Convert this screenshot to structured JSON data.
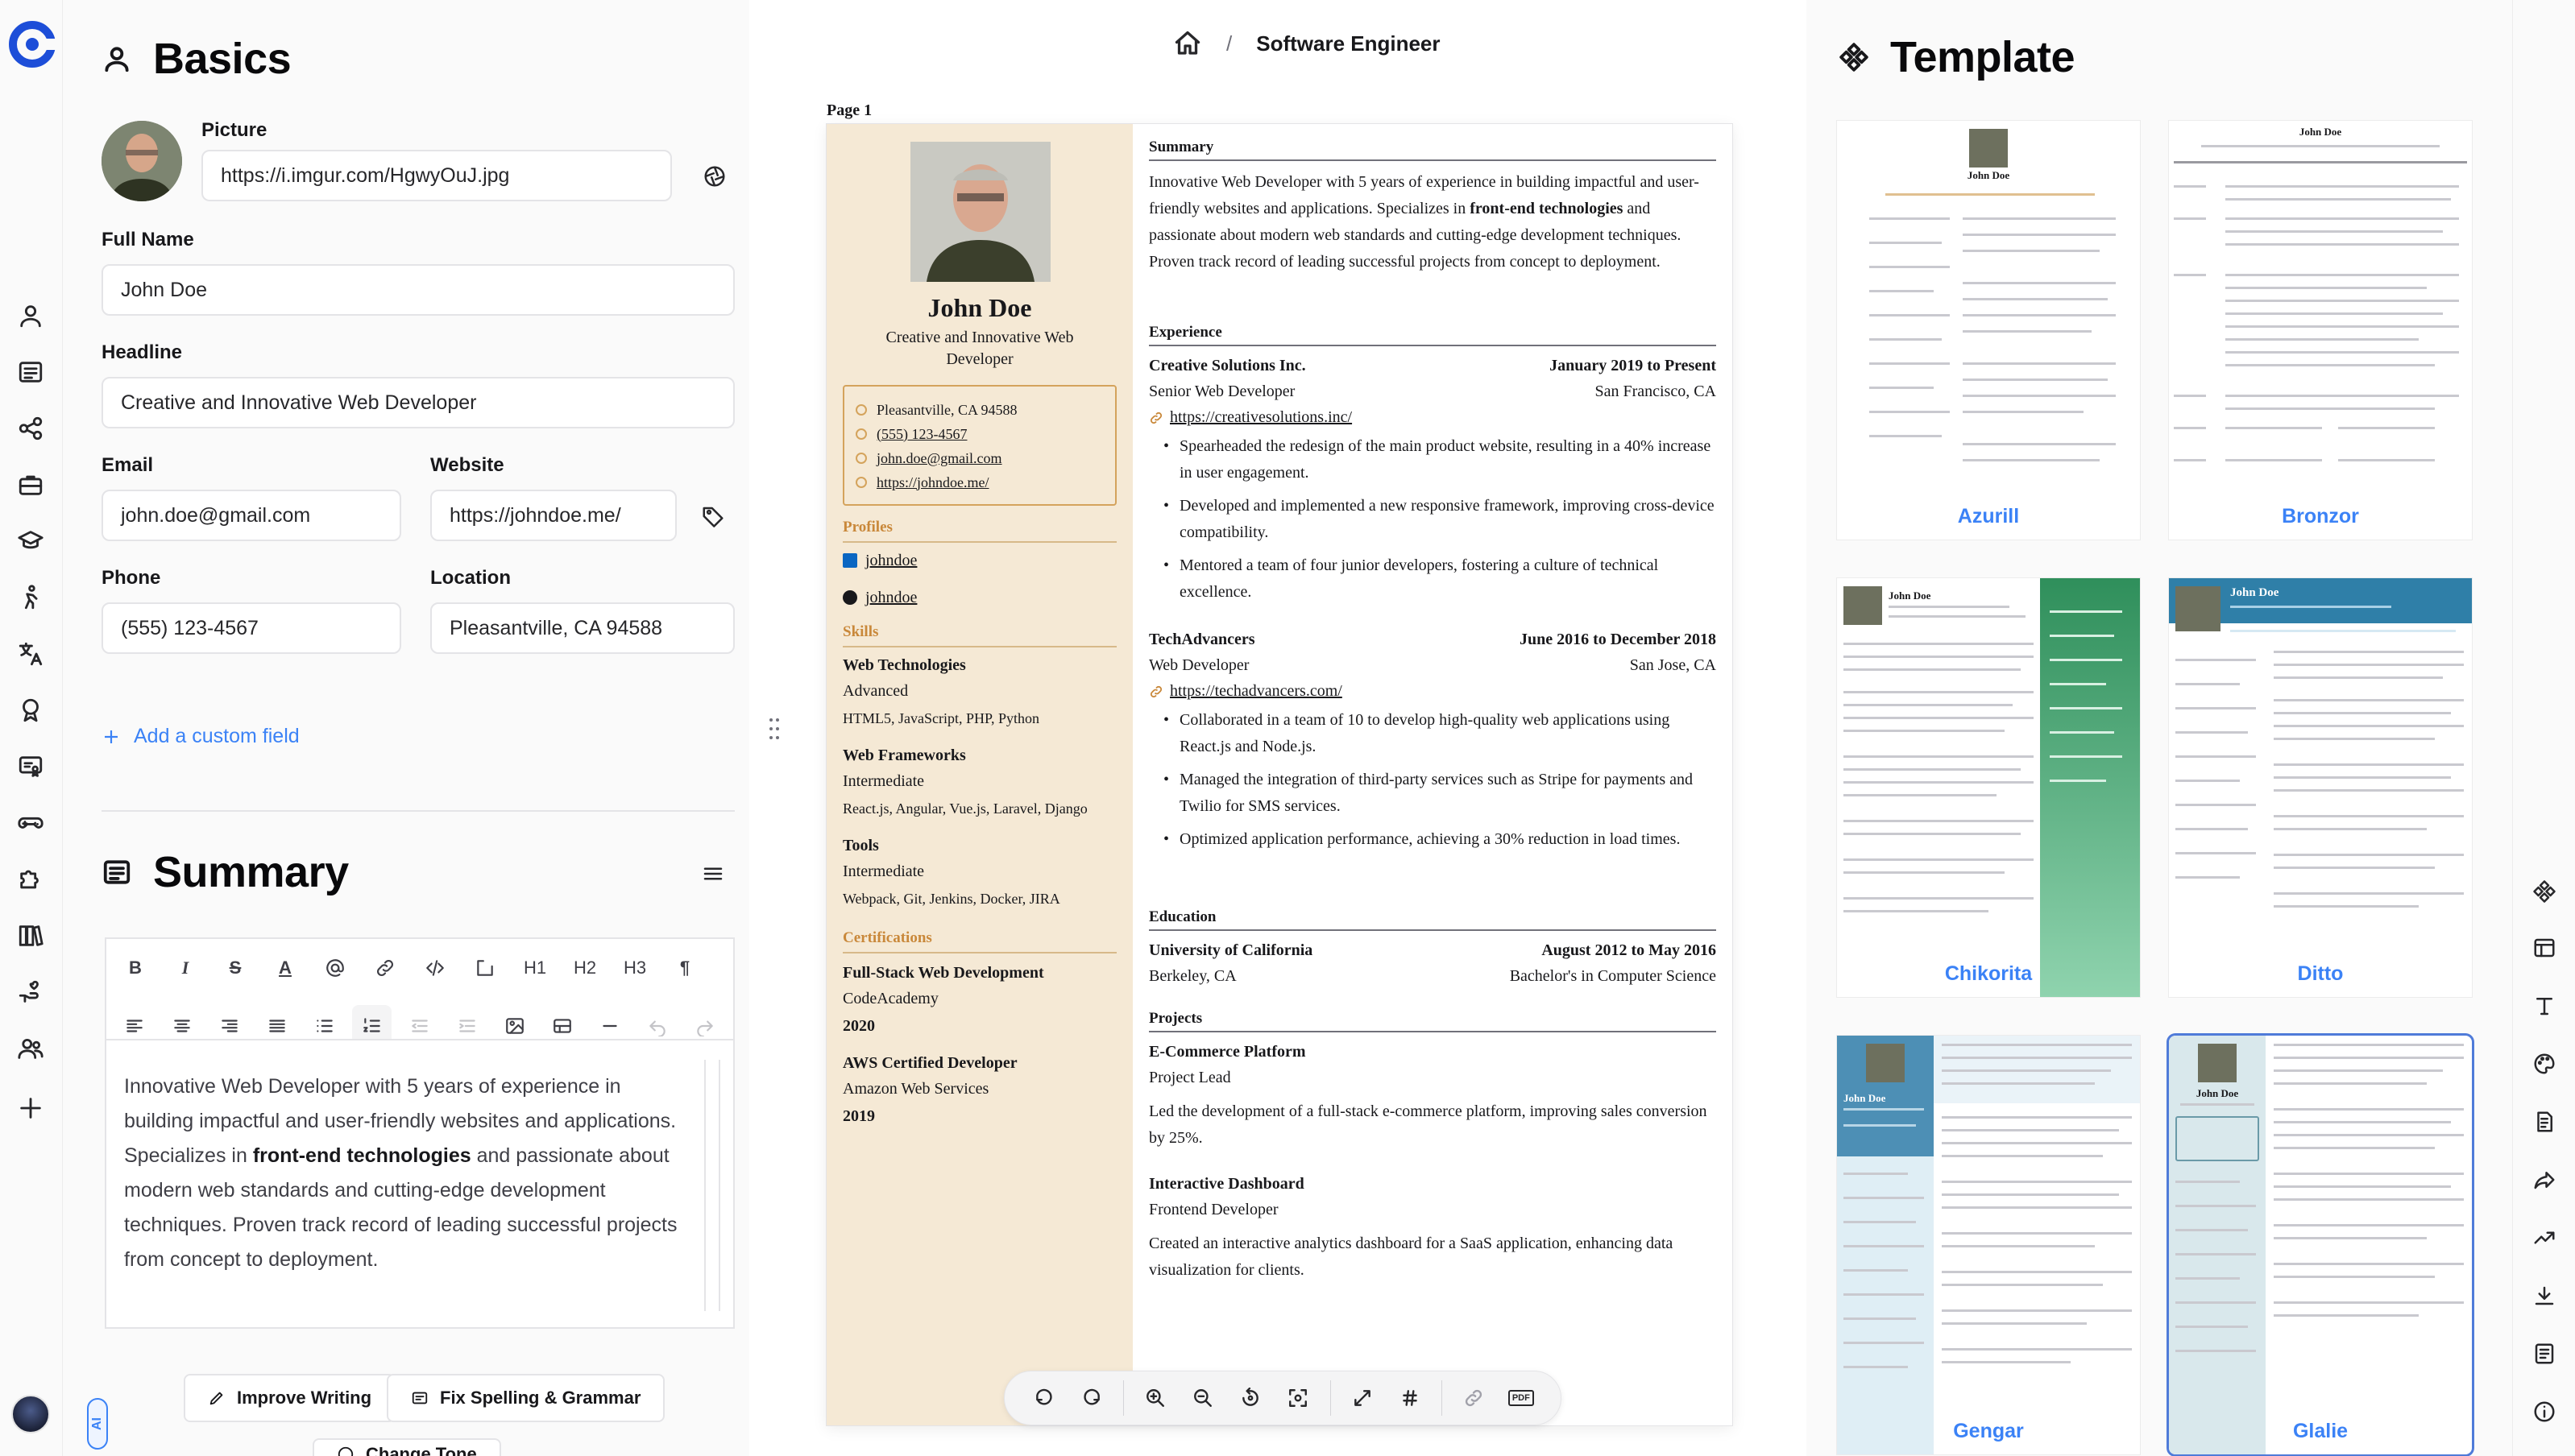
{
  "breadcrumb": {
    "title": "Software Engineer"
  },
  "basics": {
    "heading": "Basics",
    "picture_label": "Picture",
    "picture_url": "https://i.imgur.com/HgwyOuJ.jpg",
    "full_name_label": "Full Name",
    "full_name": "John Doe",
    "headline_label": "Headline",
    "headline": "Creative and Innovative Web Developer",
    "email_label": "Email",
    "email": "john.doe@gmail.com",
    "website_label": "Website",
    "website": "https://johndoe.me/",
    "phone_label": "Phone",
    "phone": "(555) 123-4567",
    "location_label": "Location",
    "location": "Pleasantville, CA 94588",
    "add_custom_field": "Add a custom field"
  },
  "summary": {
    "heading": "Summary",
    "text_before": "Innovative Web Developer with 5 years of experience in building impactful and user-friendly websites and applications. Specializes in ",
    "text_bold": "front-end technologies",
    "text_after": " and passionate about modern web standards and cutting-edge development techniques. Proven track record of leading successful projects from concept to deployment.",
    "toolbar_h1": "H1",
    "toolbar_h2": "H2",
    "toolbar_h3": "H3",
    "toolbar_para": "¶",
    "improve_writing": "Improve Writing",
    "fix_spelling": "Fix Spelling & Grammar",
    "change_tone": "Change Tone"
  },
  "ai_badge": "AI",
  "resume": {
    "page_label": "Page 1",
    "name": "John Doe",
    "headline": "Creative and Innovative Web Developer",
    "contact": {
      "location": "Pleasantville, CA 94588",
      "phone": "(555) 123-4567",
      "email": "john.doe@gmail.com",
      "website": "https://johndoe.me/"
    },
    "profiles_heading": "Profiles",
    "profiles": [
      "johndoe",
      "johndoe"
    ],
    "skills_heading": "Skills",
    "skills": [
      {
        "name": "Web Technologies",
        "level": "Advanced",
        "keywords": "HTML5, JavaScript, PHP, Python"
      },
      {
        "name": "Web Frameworks",
        "level": "Intermediate",
        "keywords": "React.js, Angular, Vue.js, Laravel, Django"
      },
      {
        "name": "Tools",
        "level": "Intermediate",
        "keywords": "Webpack, Git, Jenkins, Docker, JIRA"
      }
    ],
    "certifications_heading": "Certifications",
    "certifications": [
      {
        "name": "Full-Stack Web Development",
        "issuer": "CodeAcademy",
        "year": "2020"
      },
      {
        "name": "AWS Certified Developer",
        "issuer": "Amazon Web Services",
        "year": "2019"
      }
    ],
    "summary_heading": "Summary",
    "summary_before": "Innovative Web Developer with 5 years of experience in building impactful and user-friendly websites and applications. Specializes in ",
    "summary_bold": "front-end technologies",
    "summary_after": " and passionate about modern web standards and cutting-edge development techniques. Proven track record of leading successful projects from concept to deployment.",
    "experience_heading": "Experience",
    "experience": [
      {
        "company": "Creative Solutions Inc.",
        "date": "January 2019 to Present",
        "position": "Senior Web Developer",
        "location": "San Francisco, CA",
        "url": "https://creativesolutions.inc/",
        "bullets": [
          "Spearheaded the redesign of the main product website, resulting in a 40% increase in user engagement.",
          "Developed and implemented a new responsive framework, improving cross-device compatibility.",
          "Mentored a team of four junior developers, fostering a culture of technical excellence."
        ]
      },
      {
        "company": "TechAdvancers",
        "date": "June 2016 to December 2018",
        "position": "Web Developer",
        "location": "San Jose, CA",
        "url": "https://techadvancers.com/",
        "bullets": [
          "Collaborated in a team of 10 to develop high-quality web applications using React.js and Node.js.",
          "Managed the integration of third-party services such as Stripe for payments and Twilio for SMS services.",
          "Optimized application performance, achieving a 30% reduction in load times."
        ]
      }
    ],
    "education_heading": "Education",
    "education": {
      "school": "University of California",
      "date": "August 2012 to May 2016",
      "location": "Berkeley, CA",
      "degree": "Bachelor's in Computer Science"
    },
    "projects_heading": "Projects",
    "projects": [
      {
        "name": "E-Commerce Platform",
        "role": "Project Lead",
        "desc": "Led the development of a full-stack e-commerce platform, improving sales conversion by 25%."
      },
      {
        "name": "Interactive Dashboard",
        "role": "Frontend Developer",
        "desc": "Created an interactive analytics dashboard for a SaaS application, enhancing data visualization for clients."
      }
    ]
  },
  "bottom_bar": {
    "pdf_label": "PDF"
  },
  "templates": {
    "heading": "Template",
    "items": [
      "Azurill",
      "Bronzor",
      "Chikorita",
      "Ditto",
      "Gengar",
      "Glalie"
    ],
    "selected": "Glalie",
    "thumb_name": "John Doe"
  },
  "colors": {
    "accent_blue": "#3b82f6",
    "resume_sidebar": "#f5e9d5",
    "resume_accent": "#c9883a",
    "selected_outline": "#4f7bd9"
  }
}
